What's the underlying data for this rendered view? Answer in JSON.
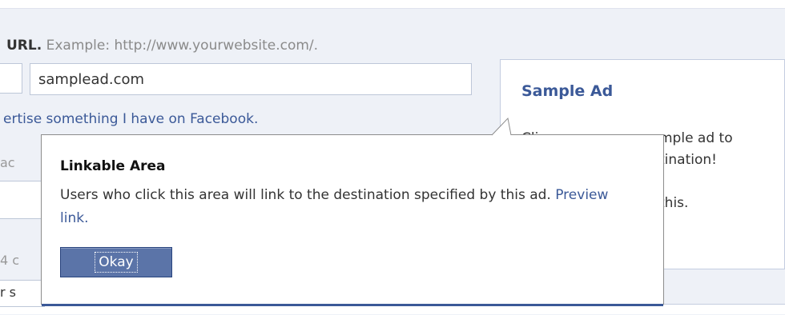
{
  "url_section": {
    "label": "URL.",
    "hint": "Example: http://www.yourwebsite.com/.",
    "value": "samplead.com"
  },
  "facebook_link": "ertise something I have on Facebook.",
  "background_stubs": {
    "title_stub": "ac",
    "count_stub": "4 c",
    "body_stub": "r s"
  },
  "sample_ad": {
    "title": "Sample Ad",
    "line1_left": "Cli",
    "line1_right": "mple ad to",
    "line2_right": "tination!",
    "line4_right": "this."
  },
  "popup": {
    "title": "Linkable Area",
    "body": "Users who click this area will link to the destination specified by this ad.",
    "preview_link": "Preview link.",
    "button_label": "Okay"
  }
}
